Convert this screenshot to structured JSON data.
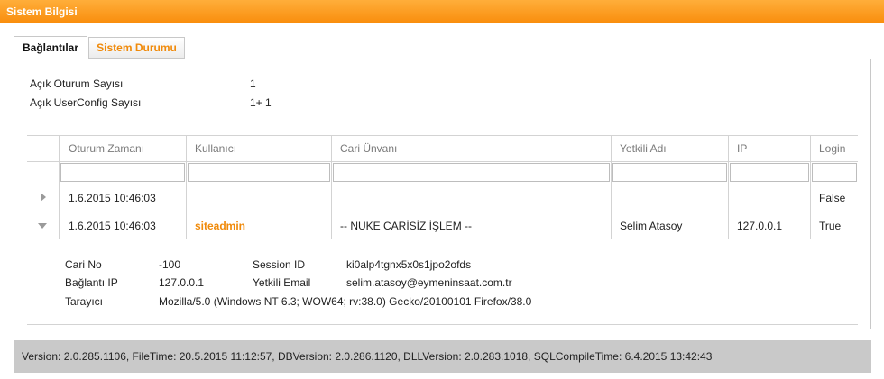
{
  "window": {
    "title": "Sistem Bilgisi"
  },
  "tabs": [
    {
      "label": "Bağlantılar",
      "active": true
    },
    {
      "label": "Sistem Durumu",
      "active": false
    }
  ],
  "summary": {
    "open_sessions_label": "Açık Oturum Sayısı",
    "open_sessions_value": "1",
    "userconfig_label": "Açık UserConfig Sayısı",
    "userconfig_value": "1+ 1"
  },
  "table": {
    "columns": [
      "Oturum Zamanı",
      "Kullanıcı",
      "Cari Ünvanı",
      "Yetkili Adı",
      "IP",
      "Login"
    ],
    "rows": [
      {
        "expanded": false,
        "session_time": "1.6.2015 10:46:03",
        "user": "",
        "company": "",
        "authorized": "",
        "ip": "",
        "login": "False"
      },
      {
        "expanded": true,
        "session_time": "1.6.2015 10:46:03",
        "user": "siteadmin",
        "company": "-- NUKE CARİSİZ İŞLEM --",
        "authorized": "Selim Atasoy",
        "ip": "127.0.0.1",
        "login": "True"
      }
    ],
    "detail": {
      "cari_no_label": "Cari No",
      "cari_no_value": "-100",
      "session_id_label": "Session ID",
      "session_id_value": "ki0alp4tgnx5x0s1jpo2ofds",
      "conn_ip_label": "Bağlantı IP",
      "conn_ip_value": "127.0.0.1",
      "auth_email_label": "Yetkili Email",
      "auth_email_value": "selim.atasoy@eymeninsaat.com.tr",
      "browser_label": "Tarayıcı",
      "browser_value": "Mozilla/5.0 (Windows NT 6.3; WOW64; rv:38.0) Gecko/20100101 Firefox/38.0"
    }
  },
  "footer": {
    "text": "Version: 2.0.285.1106, FileTime: 20.5.2015 11:12:57, DBVersion: 2.0.286.1120, DLLVersion: 2.0.283.1018, SQLCompileTime: 6.4.2015 13:42:43"
  },
  "colors": {
    "accent": "#f98d0c",
    "link": "#f08a0a",
    "footer_bg": "#c9c9c9"
  }
}
